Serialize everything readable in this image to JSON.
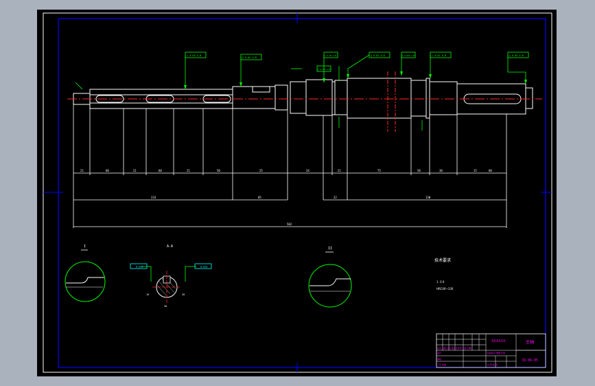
{
  "colors": {
    "background_outer": "#aab3bd",
    "canvas": "#000000",
    "line": "#ffffff",
    "dim_text": "#ffffff",
    "leader": "#00ff00",
    "centerline": "#ff2a2a",
    "frame": "#0000ff",
    "title_text": "#ff00ff",
    "title_green": "#00ff00",
    "tol_box": "#00ffff"
  },
  "drawing": {
    "views": {
      "section_i": "I",
      "section_aa": "A-A",
      "section_ii": "II"
    },
    "tolerance_frames": [
      {
        "text": "⊥ 0.03 A-B"
      },
      {
        "text": "∥ 0.02 A-B"
      },
      {
        "text": "⊥ 0.02 A-B"
      },
      {
        "text": "∥ 0.02 A-B"
      },
      {
        "text": "∥ 0.025 A-B"
      },
      {
        "text": "⊥ 0.02 A-B"
      },
      {
        "text": "∥ 0.025 A-B"
      },
      {
        "text": "∥ 0.03 A-B"
      }
    ],
    "dims_row1": [
      "21",
      "60",
      "21",
      "60",
      "21",
      "50",
      "25",
      "24",
      "21",
      "75",
      "58",
      "30",
      "15",
      "60"
    ],
    "dims_row2": [
      "233",
      "85",
      "22",
      "130"
    ],
    "dims_total": "502",
    "section_dims": [
      "0.025",
      "0.025",
      "16",
      "28",
      "30"
    ],
    "notes": {
      "title": "技术要求",
      "line1": "1.  0  0",
      "line2": "HRC40~330"
    }
  },
  "title_block": {
    "name": "主轴",
    "drawing_no": "JQ-06-05",
    "school": "XXXXXX",
    "row_a": "标记 处数 分区 更改文件号 签名 日期",
    "row_b": "设计",
    "row_c": "审核",
    "row_d": "工艺 批准",
    "scale_label": "阶段标记 重量 比例",
    "sheet": "共 张 第 张"
  }
}
